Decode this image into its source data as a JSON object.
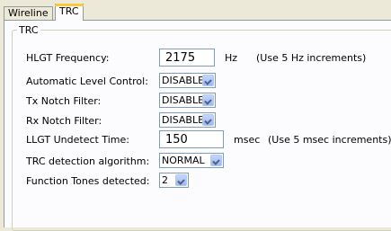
{
  "tabs": [
    {
      "label": "Wireline",
      "active": false
    },
    {
      "label": "TRC",
      "active": true
    }
  ],
  "group_title": "TRC",
  "fields": {
    "hlgt": {
      "label": "HLGT Frequency:",
      "value": "2175",
      "unit": "Hz",
      "hint": "(Use 5 Hz increments)"
    },
    "alc": {
      "label": "Automatic Level Control:",
      "value": "DISABLED"
    },
    "tx_notch": {
      "label": "Tx Notch Filter:",
      "value": "DISABLED"
    },
    "rx_notch": {
      "label": "Rx Notch Filter:",
      "value": "DISABLED"
    },
    "llgt": {
      "label": "LLGT Undetect Time:",
      "value": "150",
      "unit": "msec",
      "hint": "(Use 5 msec increments)"
    },
    "algo": {
      "label": "TRC detection algorithm:",
      "value": "NORMAL"
    },
    "tones": {
      "label": "Function Tones detected:",
      "value": "2"
    }
  }
}
